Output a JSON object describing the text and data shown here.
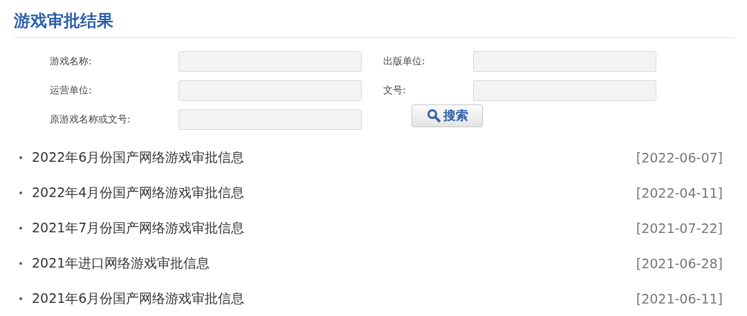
{
  "title": "游戏审批结果",
  "fields": [
    {
      "label": "游戏名称:"
    },
    {
      "label": "出版单位:"
    },
    {
      "label": "运营单位:"
    },
    {
      "label": "文号:"
    },
    {
      "label": "原游戏名称或文号:"
    }
  ],
  "search_button": {
    "label": "搜索"
  },
  "items": [
    {
      "title": "2022年6月份国产网络游戏审批信息",
      "date": "[2022-06-07]"
    },
    {
      "title": "2022年4月份国产网络游戏审批信息",
      "date": "[2022-04-11]"
    },
    {
      "title": "2021年7月份国产网络游戏审批信息",
      "date": "[2021-07-22]"
    },
    {
      "title": "2021年进口网络游戏审批信息",
      "date": "[2021-06-28]"
    },
    {
      "title": "2021年6月份国产网络游戏审批信息",
      "date": "[2021-06-11]"
    }
  ]
}
